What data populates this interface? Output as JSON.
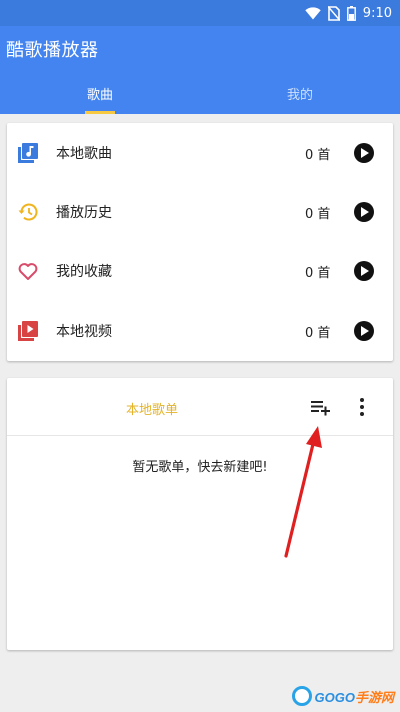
{
  "status_bar": {
    "time": "9:10",
    "icons": [
      "wifi-icon",
      "no-sim-icon",
      "battery-icon"
    ]
  },
  "app_bar": {
    "title": "酷歌播放器",
    "color": "#4384f0"
  },
  "tabs": [
    {
      "label": "歌曲",
      "active": true
    },
    {
      "label": "我的",
      "active": false
    }
  ],
  "library": {
    "items": [
      {
        "icon": "music-library-icon",
        "label": "本地歌曲",
        "count": "0 首",
        "icon_color": "#3b7bde"
      },
      {
        "icon": "history-icon",
        "label": "播放历史",
        "count": "0 首",
        "icon_color": "#f0b41e"
      },
      {
        "icon": "heart-icon",
        "label": "我的收藏",
        "count": "0 首",
        "icon_color": "#d94b6a"
      },
      {
        "icon": "video-library-icon",
        "label": "本地视频",
        "count": "0 首",
        "icon_color": "#d84444"
      }
    ]
  },
  "playlists": {
    "title": "本地歌单",
    "title_color": "#e4b32a",
    "empty_text": "暂无歌单，快去新建吧!"
  },
  "watermark": {
    "brand": "GOGO",
    "suffix": "手游网"
  }
}
